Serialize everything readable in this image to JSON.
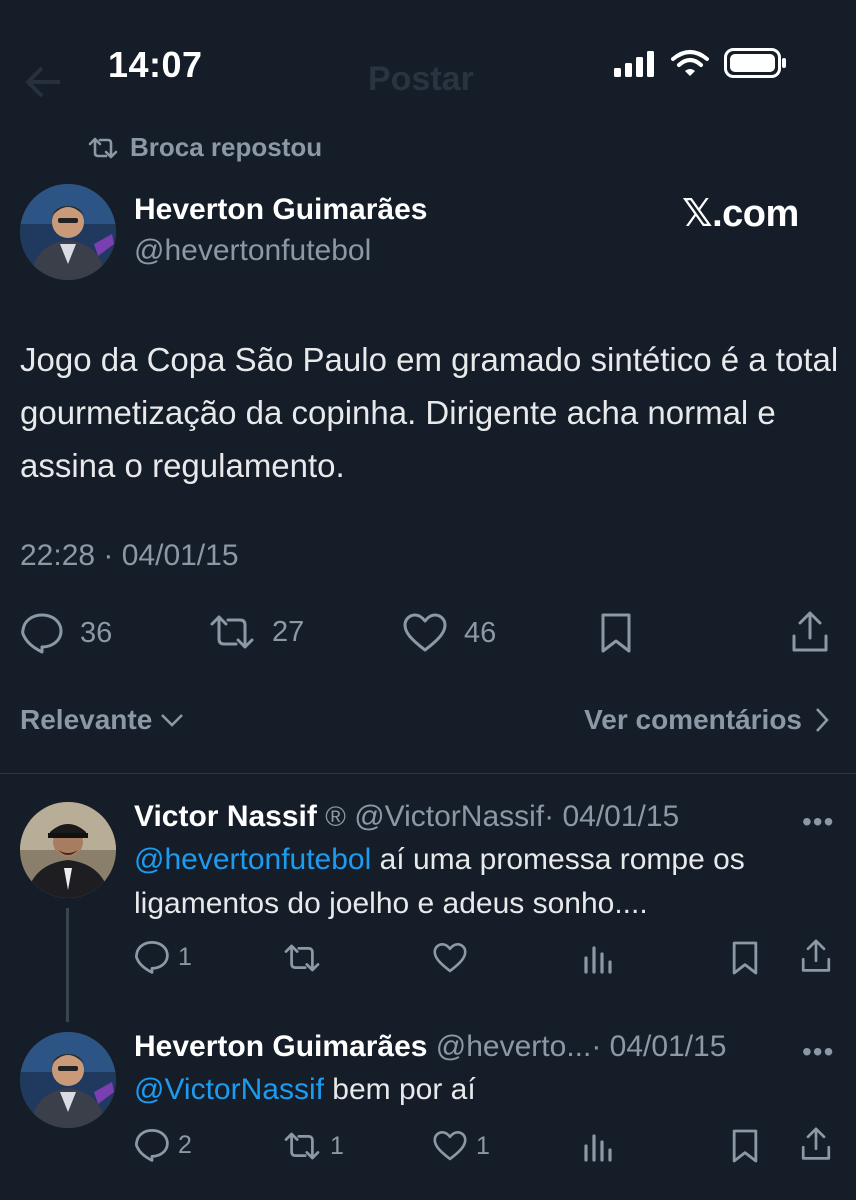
{
  "status_bar": {
    "time": "14:07"
  },
  "header": {
    "title": "Postar"
  },
  "repost_label": "Broca repostou",
  "post": {
    "author_name": "Heverton Guimarães",
    "author_handle": "@hevertonfutebol",
    "watermark": "𝕏.com",
    "text": "Jogo da Copa São Paulo em gramado sintético é a total gourmetização da copinha. Dirigente acha normal e assina o regulamento.",
    "timestamp": "22:28 · 04/01/15",
    "stats": {
      "replies": "36",
      "reposts": "27",
      "likes": "46"
    }
  },
  "filters": {
    "sort_label": "Relevante",
    "view_comments_label": "Ver comentários"
  },
  "replies": [
    {
      "name": "Victor Nassif",
      "verified_mark": "®",
      "handle": "@VictorNassif",
      "date": "· 04/01/15",
      "mention": "@hevertonfutebol",
      "text": " aí uma promessa rompe os ligamentos do joelho e adeus sonho....",
      "replies": "1",
      "reposts": "",
      "likes": ""
    },
    {
      "name": "Heverton Guimarães",
      "handle": "@heverto...",
      "date": "· 04/01/15",
      "mention": "@VictorNassif",
      "text": " bem por aí",
      "replies": "2",
      "reposts": "1",
      "likes": "1"
    }
  ],
  "more_glyph": "•••",
  "icons": [
    "back-icon",
    "repost-icon",
    "reply-icon",
    "like-icon",
    "bookmark-icon",
    "share-icon",
    "views-icon",
    "chevron-down-icon",
    "chevron-right-icon",
    "signal-icon",
    "wifi-icon",
    "battery-icon"
  ]
}
